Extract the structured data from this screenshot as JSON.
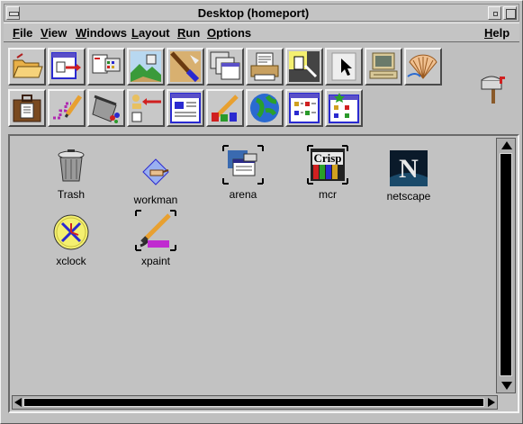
{
  "window": {
    "title": "Desktop (homeport)"
  },
  "menubar": {
    "items": [
      {
        "label": "File",
        "mnemonic": "F",
        "rest": "ile"
      },
      {
        "label": "View",
        "mnemonic": "V",
        "rest": "iew"
      },
      {
        "label": "Windows",
        "mnemonic": "W",
        "rest": "indows"
      },
      {
        "label": "Layout",
        "mnemonic": "L",
        "rest": "ayout"
      },
      {
        "label": "Run",
        "mnemonic": "R",
        "rest": "un"
      },
      {
        "label": "Options",
        "mnemonic": "O",
        "rest": "ptions"
      }
    ],
    "help": {
      "label": "Help",
      "mnemonic": "H",
      "rest": "elp"
    }
  },
  "toolbar": {
    "row1": [
      "open-folder-icon",
      "window-arrow-icon",
      "window-list-icon",
      "landscape-icon",
      "paint-icon",
      "stacked-windows-icon",
      "printer-icon",
      "highlighter-icon",
      "cursor-icon",
      "computer-icon",
      "shell-icon"
    ],
    "row2": [
      "briefcase-icon",
      "pencil-draw-icon",
      "trash-spill-icon",
      "arrow-transfer-icon",
      "window-panel-icon",
      "tools-icon",
      "globe-icon",
      "window-grid-icon",
      "window-grid-star-icon"
    ]
  },
  "desktop": {
    "icons": [
      {
        "name": "trash",
        "label": "Trash"
      },
      {
        "name": "workman",
        "label": "workman"
      },
      {
        "name": "arena",
        "label": "arena"
      },
      {
        "name": "mcr",
        "label": "mcr"
      },
      {
        "name": "netscape",
        "label": "netscape"
      },
      {
        "name": "xclock",
        "label": "xclock"
      },
      {
        "name": "xpaint",
        "label": "xpaint"
      }
    ],
    "mcr_badge": "Crisp",
    "netscape_letter": "N"
  },
  "colors": {
    "background": "#c0c0c0",
    "scroll_thumb": "#000000",
    "toolbar_accent": "#5a4fc8"
  }
}
